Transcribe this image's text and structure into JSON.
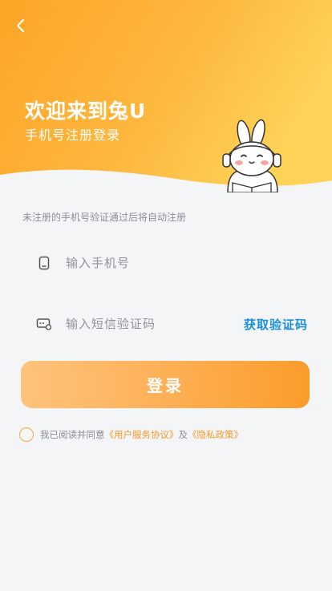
{
  "header": {
    "title": "欢迎来到兔U",
    "subtitle": "手机号注册登录"
  },
  "form": {
    "hint": "未注册的手机号验证通过后将自动注册",
    "phone_placeholder": "输入手机号",
    "code_placeholder": "输入短信验证码",
    "get_code_label": "获取验证码",
    "login_label": "登录"
  },
  "agreement": {
    "prefix": "我已阅读并同意",
    "user_agreement": "《用户服务协议》",
    "and": "及",
    "privacy_policy": "《隐私政策》"
  },
  "colors": {
    "accent": "#fdae52",
    "link_blue": "#1a8fe0",
    "background": "#f4f5f7"
  },
  "icons": {
    "back": "chevron-left-icon",
    "phone": "phone-icon",
    "code": "sms-code-icon",
    "mascot": "rabbit-mascot"
  }
}
